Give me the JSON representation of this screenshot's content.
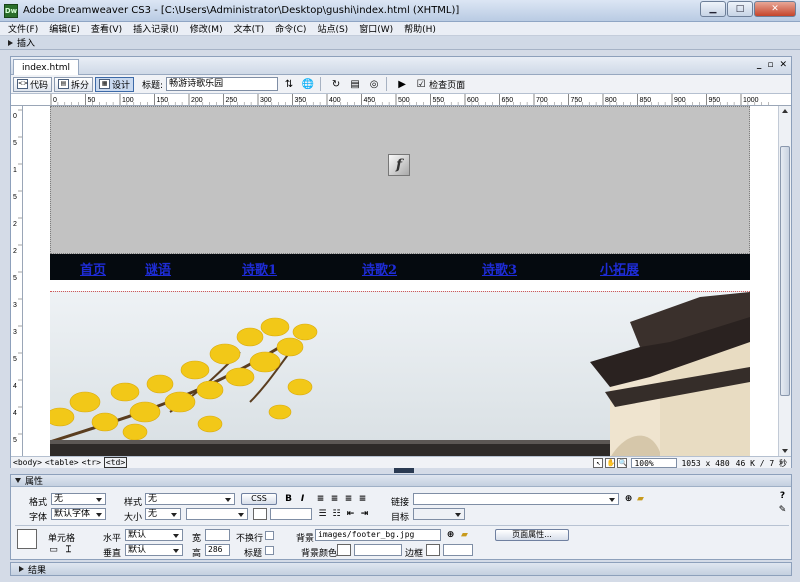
{
  "app": {
    "icon_text": "Dw",
    "title": "Adobe Dreamweaver CS3 - [C:\\Users\\Administrator\\Desktop\\gushi\\index.html (XHTML)]"
  },
  "window_buttons": {
    "minimize": "▁",
    "maximize": "□",
    "close": "✕"
  },
  "menus": [
    "文件(F)",
    "编辑(E)",
    "查看(V)",
    "插入记录(I)",
    "修改(M)",
    "文本(T)",
    "命令(C)",
    "站点(S)",
    "窗口(W)",
    "帮助(H)"
  ],
  "insert_panel": {
    "label": "插入"
  },
  "document": {
    "tab_label": "index.html",
    "controls": [
      "_",
      "▫",
      "✕"
    ],
    "view_buttons": {
      "code": "代码",
      "split": "拆分",
      "design": "设计"
    },
    "title_label": "标题:",
    "title_value": "畅游诗歌乐园",
    "check_page": "检查页面"
  },
  "ruler": {
    "ticks": [
      "0",
      "50",
      "100",
      "150",
      "200",
      "250",
      "300",
      "350",
      "400",
      "450",
      "500",
      "550",
      "600",
      "650",
      "700",
      "750",
      "800",
      "850",
      "900",
      "950",
      "1000"
    ],
    "vticks": [
      "0",
      "5",
      "1",
      "5",
      "2",
      "2",
      "5",
      "3",
      "3",
      "5",
      "4",
      "4",
      "5"
    ]
  },
  "page": {
    "nav_links": [
      "首页",
      "谜语",
      "诗歌1",
      "诗歌2",
      "诗歌3",
      "小拓展"
    ]
  },
  "tag_selector": [
    "<body>",
    "<table>",
    "<tr>",
    "<td>"
  ],
  "status": {
    "zoom": "100%",
    "dimensions": "1053 x 480",
    "size": "46 K / 7 秒"
  },
  "properties": {
    "header": "属性",
    "format_label": "格式",
    "format_value": "无",
    "style_label": "样式",
    "style_value": "无",
    "css_button": "CSS",
    "bold": "B",
    "italic": "I",
    "link_label": "链接",
    "font_label": "字体",
    "font_value": "默认字体",
    "size_label": "大小",
    "size_value": "无",
    "target_label": "目标",
    "cell_label": "单元格",
    "horz_label": "水平",
    "horz_value": "默认",
    "width_label": "宽",
    "nowrap_label": "不换行",
    "bg_label": "背景",
    "bg_value": "images/footer_bg.jpg",
    "page_props_button": "页面属性...",
    "vert_label": "垂直",
    "vert_value": "默认",
    "height_label": "高",
    "height_value": "286",
    "header_label": "标题",
    "bgcolor_label": "背景颜色",
    "border_label": "边框"
  },
  "results_panel": {
    "label": "结果"
  }
}
